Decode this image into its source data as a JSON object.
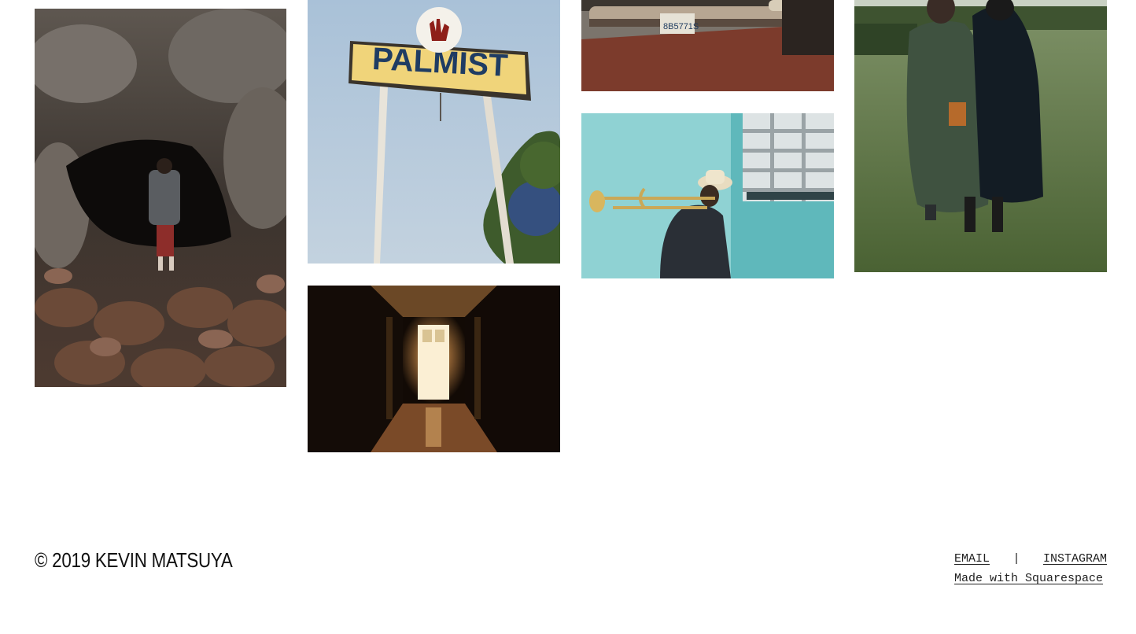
{
  "gallery": [
    {
      "id": "cave",
      "alt": "Person climbing into lava rock cave"
    },
    {
      "id": "palmist",
      "alt": "Palmist sign on poles against sky",
      "sign_text": "PALMIST"
    },
    {
      "id": "truck",
      "alt": "Vintage truck bumper with license plate",
      "plate_text": "8B5771S"
    },
    {
      "id": "women",
      "alt": "Two women walking in grass field"
    },
    {
      "id": "hallway",
      "alt": "Dark hallway with glowing doors"
    },
    {
      "id": "trombone",
      "alt": "Man playing trombone against teal wall"
    }
  ],
  "footer": {
    "copyright": "© 2019 KEVIN MATSUYA",
    "email_label": "EMAIL",
    "separator": "|",
    "instagram_label": "INSTAGRAM",
    "squarespace_label": "Made with Squarespace"
  },
  "colors": {
    "background": "#ffffff",
    "text": "#111111",
    "sky": "#9fb7cf",
    "teal_wall": "#6fc2c4",
    "grass": "#5f7a45"
  }
}
